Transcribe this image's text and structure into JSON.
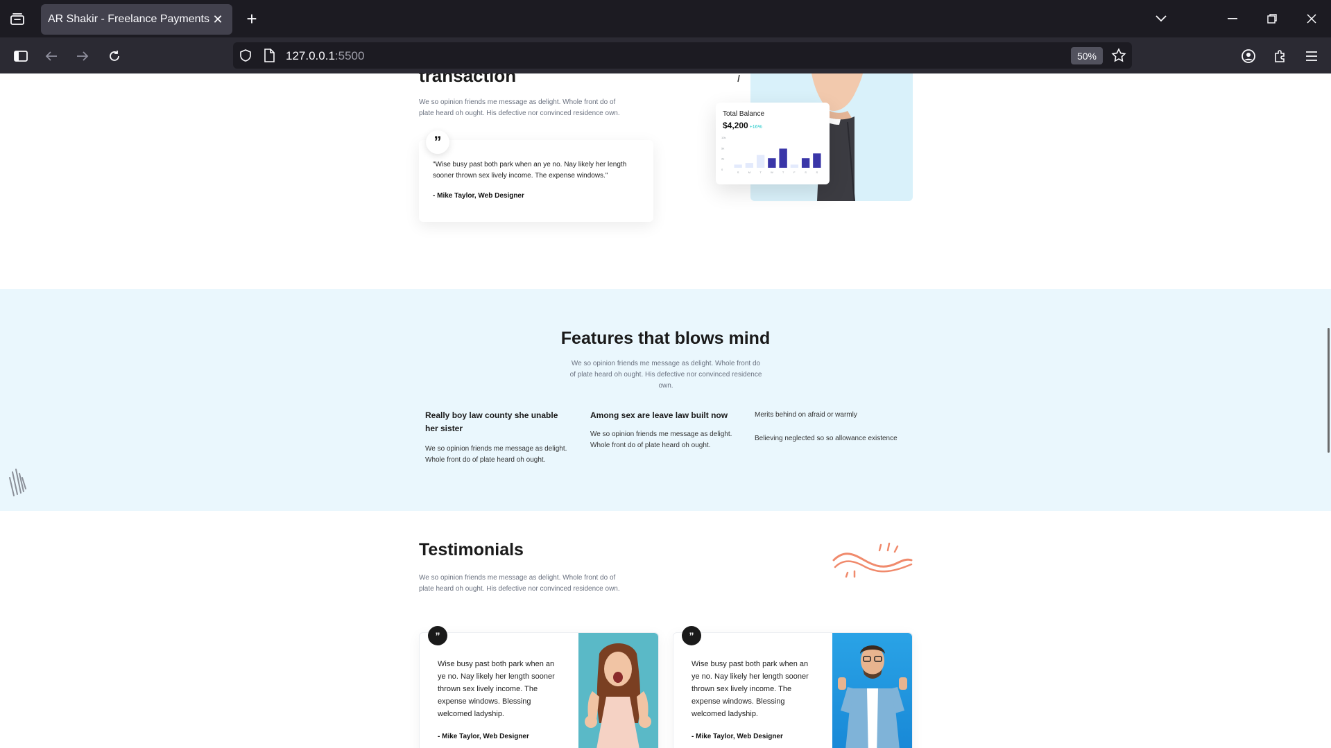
{
  "browser": {
    "tab_title": "AR Shakir - Freelance Payments",
    "url_host": "127.0.0.1",
    "url_port": ":5500",
    "zoom": "50%"
  },
  "section_transaction": {
    "title": "transaction",
    "description": "We so opinion friends me message as delight. Whole front do of plate heard oh ought. His defective nor convinced residence own.",
    "quote_mark": "”",
    "quote": "\"Wise busy past both park when an ye no. Nay likely her length sooner thrown sex lively income. The expense windows.\"",
    "author": "- Mike Taylor, Web Designer",
    "balance_card": {
      "title": "Total Balance",
      "value": "$4,200",
      "change": "+16%"
    }
  },
  "chart_data": {
    "type": "bar",
    "categories": [
      "S",
      "M",
      "T",
      "W",
      "T",
      "F",
      "S",
      "S"
    ],
    "y_ticks": [
      "10k",
      "5k",
      "2k",
      "0"
    ],
    "series": [
      {
        "values": [
          1,
          1.5,
          4,
          3,
          6,
          1,
          3,
          4.5
        ]
      }
    ],
    "highlight": [
      false,
      false,
      false,
      true,
      true,
      false,
      true,
      true
    ],
    "ylim": [
      0,
      10
    ]
  },
  "features": {
    "title": "Features that blows mind",
    "description": "We so opinion friends me message as delight. Whole front do of plate heard oh ought. His defective nor convinced residence own.",
    "col1_heading": "Really boy law county she unable her sister",
    "col1_text": "We so opinion friends me message as delight. Whole front do of plate heard oh ought.",
    "col2_heading": "Among sex are leave law built now",
    "col2_text": "We so opinion friends me message as delight. Whole front do of plate heard oh ought.",
    "col3_item1": "Merits behind on afraid or warmly",
    "col3_item2": "Believing neglected so so allowance existence"
  },
  "testimonials": {
    "title": "Testimonials",
    "description": "We so opinion friends me message as delight. Whole front do of plate heard oh ought. His defective nor convinced residence own.",
    "cards": [
      {
        "mark": "”",
        "text": "Wise busy past both park when an ye no. Nay likely her length sooner thrown sex lively income. The expense windows. Blessing welcomed ladyship.",
        "author": "- Mike Taylor, Web Designer"
      },
      {
        "mark": "”",
        "text": "Wise busy past both park when an ye no. Nay likely her length sooner thrown sex lively income. The expense windows. Blessing welcomed ladyship.",
        "author": "- Mike Taylor, Web Designer"
      }
    ]
  },
  "colors": {
    "browser_tabbar": "#1c1b22",
    "browser_navbar": "#2b2a33",
    "features_bg": "#eaf7fd",
    "hero_bg": "#d9f1fa",
    "bar_highlight": "#3a36a8",
    "bar_muted": "#e3eafc",
    "accent_coral": "#f08a6c",
    "change_teal": "#1ec8c8"
  }
}
